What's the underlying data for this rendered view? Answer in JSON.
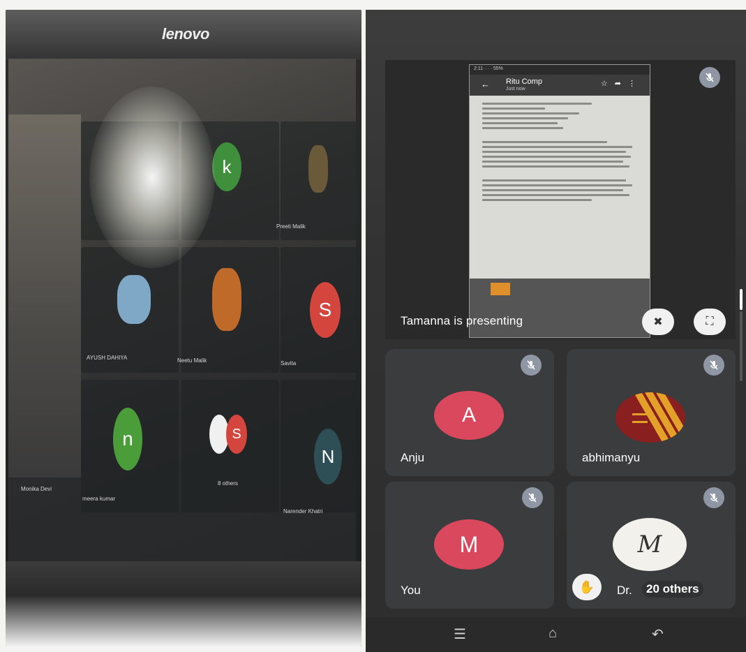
{
  "left_photo": {
    "brand": "lenovo",
    "participants": [
      {
        "label": "k",
        "color": "#3f8f3c"
      },
      {
        "label": "S",
        "color": "#d4453e",
        "name": "Savita"
      },
      {
        "label": "n",
        "color": "#4b9d3a"
      },
      {
        "label": "S",
        "color": "#d4453e"
      },
      {
        "label": "N",
        "color": "#2f4f56"
      }
    ],
    "tile_names": [
      "Preeti Malik",
      "AYUSH DAHIYA",
      "Neetu Malik",
      "Savita",
      "meera kumar",
      "8 others",
      "Narender Khatri",
      "Monika Devi"
    ]
  },
  "right_photo": {
    "shared_screen": {
      "title": "Ritu Comp",
      "subtitle": "Just now"
    },
    "presenting_text": "Tamanna is presenting",
    "participants": [
      {
        "name": "Anju",
        "initial": "A",
        "color": "#d9485c"
      },
      {
        "name": "abhimanyu",
        "initial": "",
        "color": "#8a1f1f"
      },
      {
        "name": "You",
        "initial": "M",
        "color": "#d9485c"
      },
      {
        "name": "Dr.",
        "initial": "M",
        "color": "#f3f1ec"
      }
    ],
    "others_label": "20 others"
  }
}
